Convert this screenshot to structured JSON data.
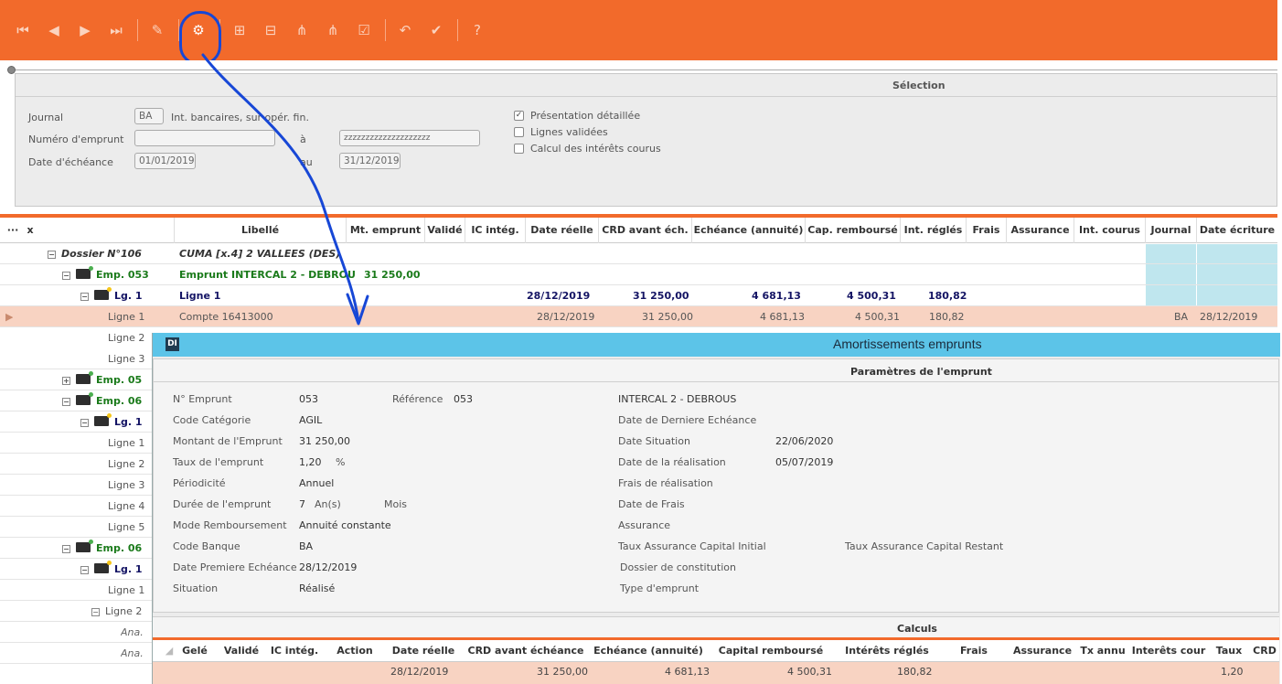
{
  "toolbar": {
    "icons": [
      "first-icon",
      "prev-icon",
      "next-icon",
      "last-icon",
      "edit-icon",
      "gear-icon",
      "plus-box-icon",
      "minus-box-icon",
      "tree-expand-icon",
      "tree-collapse-icon",
      "check-box-icon",
      "undo-icon",
      "check-icon",
      "help-icon"
    ],
    "accent": "#f26a2b"
  },
  "selection": {
    "title": "Sélection",
    "journal_label": "Journal",
    "journal_code": "BA",
    "journal_desc": "Int. bancaires, sur opér. fin.",
    "numero_label": "Numéro d'emprunt",
    "numero_from": "",
    "numero_a": "à",
    "numero_to": "zzzzzzzzzzzzzzzzzzzz",
    "date_label": "Date d'échéance",
    "date_from": "01/01/2019",
    "date_au": "au",
    "date_to": "31/12/2019",
    "cb_presentation": "Présentation détaillée",
    "cb_lignes": "Lignes validées",
    "cb_calcul": "Calcul des intérêts courus"
  },
  "grid": {
    "col_dots": "···",
    "col_x": "x",
    "columns": [
      "Libellé",
      "Mt. emprunt",
      "Validé",
      "IC intég.",
      "Date réelle",
      "CRD avant éch.",
      "Echéance (annuité)",
      "Cap. remboursé",
      "Int. réglés",
      "Frais",
      "Assurance",
      "Int. courus",
      "Journal",
      "Date écriture"
    ],
    "rows": {
      "r0": {
        "tree": "Dossier N°106",
        "libelle": "CUMA [x.4] 2 VALLEES (DES)"
      },
      "r1": {
        "tree": "Emp. 053",
        "libelle": "Emprunt INTERCAL 2 - DEBROU",
        "mt": "31 250,00"
      },
      "r2": {
        "tree": "Lg. 1",
        "libelle": "Ligne 1",
        "date": "28/12/2019",
        "crd": "31 250,00",
        "ech": "4 681,13",
        "cap": "4 500,31",
        "int": "180,82"
      },
      "r3": {
        "tree": "Ligne 1",
        "libelle": "Compte 16413000",
        "date": "28/12/2019",
        "crd": "31 250,00",
        "ech": "4 681,13",
        "cap": "4 500,31",
        "int": "180,82",
        "journal": "BA",
        "date_ecr": "28/12/2019"
      },
      "r4": {
        "tree": "Ligne 2"
      },
      "r5": {
        "tree": "Ligne 3"
      },
      "r6": {
        "tree": "Emp. 05"
      },
      "r7": {
        "tree": "Emp. 06"
      },
      "r8": {
        "tree": "Lg. 1"
      },
      "r9": {
        "tree": "Ligne 1"
      },
      "r10": {
        "tree": "Ligne 2"
      },
      "r11": {
        "tree": "Ligne 3"
      },
      "r12": {
        "tree": "Ligne 4"
      },
      "r13": {
        "tree": "Ligne 5"
      },
      "r14": {
        "tree": "Emp. 06"
      },
      "r15": {
        "tree": "Lg. 1"
      },
      "r16": {
        "tree": "Ligne 1"
      },
      "r17": {
        "tree": "Ligne 2"
      },
      "r18": {
        "tree": "Ana."
      },
      "r19": {
        "tree": "Ana."
      }
    }
  },
  "dialog": {
    "logo": "DI",
    "title": "Amortissements emprunts",
    "params_title": "Paramètres de l'emprunt",
    "labels": {
      "num": "N° Emprunt",
      "ref": "Référence",
      "cat": "Code Catégorie",
      "mont": "Montant de l'Emprunt",
      "taux": "Taux de l'emprunt",
      "per": "Périodicité",
      "duree": "Durée de l'emprunt",
      "mode": "Mode Remboursement",
      "banque": "Code Banque",
      "premiere": "Date Premiere Echéance",
      "situation": "Situation",
      "derniere": "Date de Derniere Echéance",
      "date_sit": "Date Situation",
      "date_real": "Date de la réalisation",
      "frais_real": "Frais de réalisation",
      "date_frais": "Date de Frais",
      "assurance": "Assurance",
      "taux_ass_init": "Taux Assurance Capital Initial",
      "taux_ass_rest": "Taux Assurance Capital Restant",
      "dossier_const": "Dossier de constitution",
      "type": "Type d'emprunt"
    },
    "values": {
      "num": "053",
      "ref": "053",
      "intitule": "INTERCAL 2 - DEBROUS",
      "cat": "AGIL",
      "mont": "31 250,00",
      "taux": "1,20",
      "taux_unit": "%",
      "per": "Annuel",
      "duree": "7",
      "duree_unit": "An(s)",
      "mois": "Mois",
      "mode": "Annuité constante",
      "banque": "BA",
      "premiere": "28/12/2019",
      "situation": "Réalisé",
      "date_sit": "22/06/2020",
      "date_real": "05/07/2019"
    },
    "calc_title": "Calculs",
    "calc_columns": [
      "Gelé",
      "Validé",
      "IC intég.",
      "Action",
      "Date réelle",
      "CRD avant échéance",
      "Echéance (annuité)",
      "Capital remboursé",
      "Intérêts réglés",
      "Frais",
      "Assurance",
      "Tx annu",
      "Interêts cour",
      "Taux",
      "CRD"
    ],
    "calc_row": {
      "date": "28/12/2019",
      "crd": "31 250,00",
      "ech": "4 681,13",
      "cap": "4 500,31",
      "int": "180,82",
      "taux": "1,20"
    }
  }
}
